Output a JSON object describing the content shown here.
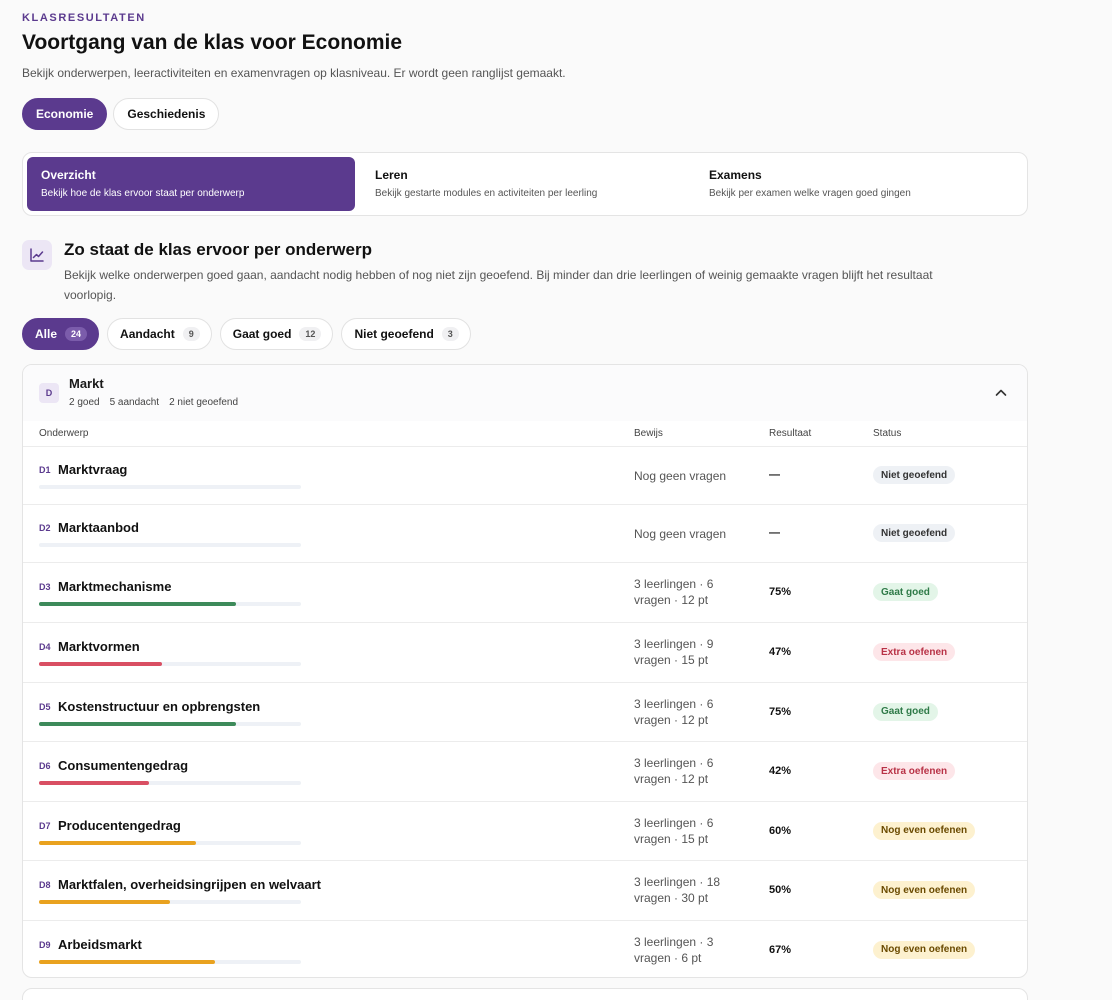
{
  "header": {
    "eyebrow": "KLASRESULTATEN",
    "title": "Voortgang van de klas voor Economie",
    "subtitle": "Bekijk onderwerpen, leeractiviteiten en examenvragen op klasniveau. Er wordt geen ranglijst gemaakt."
  },
  "subjects": [
    {
      "label": "Economie",
      "active": true
    },
    {
      "label": "Geschiedenis",
      "active": false
    }
  ],
  "views": [
    {
      "label": "Overzicht",
      "desc": "Bekijk hoe de klas ervoor staat per onderwerp",
      "active": true
    },
    {
      "label": "Leren",
      "desc": "Bekijk gestarte modules en activiteiten per leerling",
      "active": false
    },
    {
      "label": "Examens",
      "desc": "Bekijk per examen welke vragen goed gingen",
      "active": false
    }
  ],
  "section": {
    "icon": "trend-chart-icon",
    "title": "Zo staat de klas ervoor per onderwerp",
    "description": "Bekijk welke onderwerpen goed gaan, aandacht nodig hebben of nog niet zijn geoefend. Bij minder dan drie leerlingen of weinig gemaakte vragen blijft het resultaat voorlopig."
  },
  "filters": [
    {
      "label": "Alle",
      "count": "24",
      "active": true
    },
    {
      "label": "Aandacht",
      "count": "9",
      "active": false
    },
    {
      "label": "Gaat goed",
      "count": "12",
      "active": false
    },
    {
      "label": "Niet geoefend",
      "count": "3",
      "active": false
    }
  ],
  "domain": {
    "badge": "D",
    "title": "Markt",
    "summary": [
      "2 goed",
      "5 aandacht",
      "2 niet geoefend"
    ],
    "collapse_icon": "chevron-up-icon"
  },
  "table": {
    "headers": {
      "topic": "Onderwerp",
      "evidence": "Bewijs",
      "result": "Resultaat",
      "status": "Status"
    },
    "rows": [
      {
        "code": "D1",
        "topic": "Marktvraag",
        "evidence_1": "Nog geen vragen",
        "evidence_2": "",
        "result": "—",
        "progress": 0,
        "status": "Niet geoefend",
        "tone": "none"
      },
      {
        "code": "D2",
        "topic": "Marktaanbod",
        "evidence_1": "Nog geen vragen",
        "evidence_2": "",
        "result": "—",
        "progress": 0,
        "status": "Niet geoefend",
        "tone": "none"
      },
      {
        "code": "D3",
        "topic": "Marktmechanisme",
        "evidence_1": "3 leerlingen · 6",
        "evidence_2": "vragen · 12 pt",
        "result": "75%",
        "progress": 75,
        "status": "Gaat goed",
        "tone": "good"
      },
      {
        "code": "D4",
        "topic": "Marktvormen",
        "evidence_1": "3 leerlingen · 9",
        "evidence_2": "vragen · 15 pt",
        "result": "47%",
        "progress": 47,
        "status": "Extra oefenen",
        "tone": "bad"
      },
      {
        "code": "D5",
        "topic": "Kostenstructuur en opbrengsten",
        "evidence_1": "3 leerlingen · 6",
        "evidence_2": "vragen · 12 pt",
        "result": "75%",
        "progress": 75,
        "status": "Gaat goed",
        "tone": "good"
      },
      {
        "code": "D6",
        "topic": "Consumentengedrag",
        "evidence_1": "3 leerlingen · 6",
        "evidence_2": "vragen · 12 pt",
        "result": "42%",
        "progress": 42,
        "status": "Extra oefenen",
        "tone": "bad"
      },
      {
        "code": "D7",
        "topic": "Producentengedrag",
        "evidence_1": "3 leerlingen · 6",
        "evidence_2": "vragen · 15 pt",
        "result": "60%",
        "progress": 60,
        "status": "Nog even oefenen",
        "tone": "mid"
      },
      {
        "code": "D8",
        "topic": "Marktfalen, overheidsingrijpen en welvaart",
        "evidence_1": "3 leerlingen · 18",
        "evidence_2": "vragen · 30 pt",
        "result": "50%",
        "progress": 50,
        "status": "Nog even oefenen",
        "tone": "mid"
      },
      {
        "code": "D9",
        "topic": "Arbeidsmarkt",
        "evidence_1": "3 leerlingen · 3",
        "evidence_2": "vragen · 6 pt",
        "result": "67%",
        "progress": 67,
        "status": "Nog even oefenen",
        "tone": "mid"
      }
    ]
  },
  "colors": {
    "accent": "#5b3a8e",
    "good": "#3d8a5a",
    "bad": "#d94f63",
    "mid": "#e9a21f",
    "badge_none_bg": "#eef1f5",
    "badge_none_fg": "#333333",
    "badge_good_bg": "#e3f5e8",
    "badge_good_fg": "#2f7a48",
    "badge_bad_bg": "#fde6e9",
    "badge_bad_fg": "#b83246",
    "badge_mid_bg": "#fdf1cf",
    "badge_mid_fg": "#6a4a00"
  }
}
